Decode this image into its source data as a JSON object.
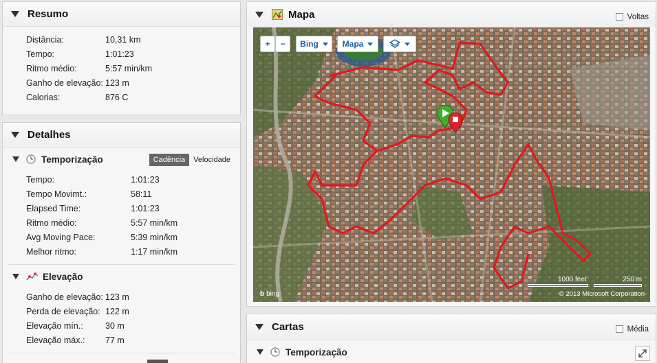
{
  "resumo": {
    "title": "Resumo",
    "rows": [
      {
        "label": "Distância:",
        "value": "10,31 km"
      },
      {
        "label": "Tempo:",
        "value": "1:01:23"
      },
      {
        "label": "Ritmo médio:",
        "value": "5:57 min/km"
      },
      {
        "label": "Ganho de elevação:",
        "value": "123 m"
      },
      {
        "label": "Calorias:",
        "value": "876 C"
      }
    ]
  },
  "detalhes": {
    "title": "Detalhes",
    "temporizacao": {
      "title": "Temporização",
      "tabs": [
        "Cadência",
        "Velocidade"
      ],
      "rows": [
        {
          "label": "Tempo:",
          "value": "1:01:23"
        },
        {
          "label": "Tempo Movimt.:",
          "value": "58:11"
        },
        {
          "label": "Elapsed Time:",
          "value": "1:01:23"
        },
        {
          "label": "Ritmo médio:",
          "value": "5:57 min/km"
        },
        {
          "label": "Avg Moving Pace:",
          "value": "5:39 min/km"
        },
        {
          "label": "Melhor ritmo:",
          "value": "1:17 min/km"
        }
      ]
    },
    "elevacao": {
      "title": "Elevação",
      "rows": [
        {
          "label": "Ganho de elevação:",
          "value": "123 m"
        },
        {
          "label": "Perda de elevação:",
          "value": "122 m"
        },
        {
          "label": "Elevação mín.:",
          "value": "30 m"
        },
        {
          "label": "Elevação máx.:",
          "value": "77 m"
        }
      ]
    }
  },
  "mapa": {
    "title": "Mapa",
    "voltas_label": "Voltas",
    "controls": {
      "zoom_in": "+",
      "zoom_out": "−",
      "provider": "Bing",
      "type": "Mapa"
    },
    "scale_feet": "1000 feet",
    "scale_m": "250 m",
    "copyright": "© 2013 Microsoft Corporation",
    "bing_logo": "bing"
  },
  "cartas": {
    "title": "Cartas",
    "media_label": "Média",
    "sub_title": "Temporização"
  },
  "colors": {
    "route": "#e0191e",
    "start": "#3cae2a",
    "end": "#d9242b",
    "tab_active": "#666666"
  }
}
